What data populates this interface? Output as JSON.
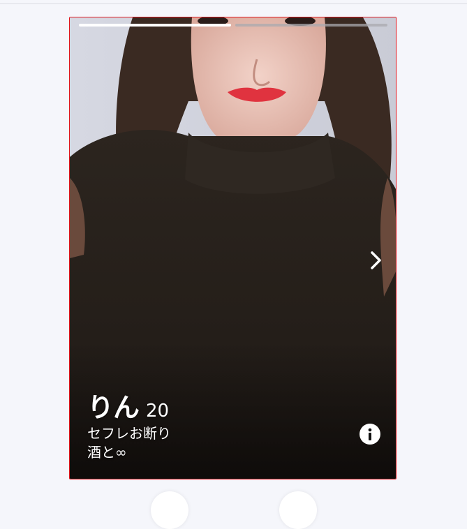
{
  "card": {
    "photo_count": 2,
    "active_photo": 1,
    "profile": {
      "name": "りん",
      "age": "20",
      "bio": [
        "セフレお断り",
        "酒と∞"
      ]
    }
  },
  "icons": {
    "next": "chevron-right-icon",
    "info": "info-icon"
  },
  "colors": {
    "card_border": "#e0141b",
    "page_background": "#f5f6fb"
  }
}
